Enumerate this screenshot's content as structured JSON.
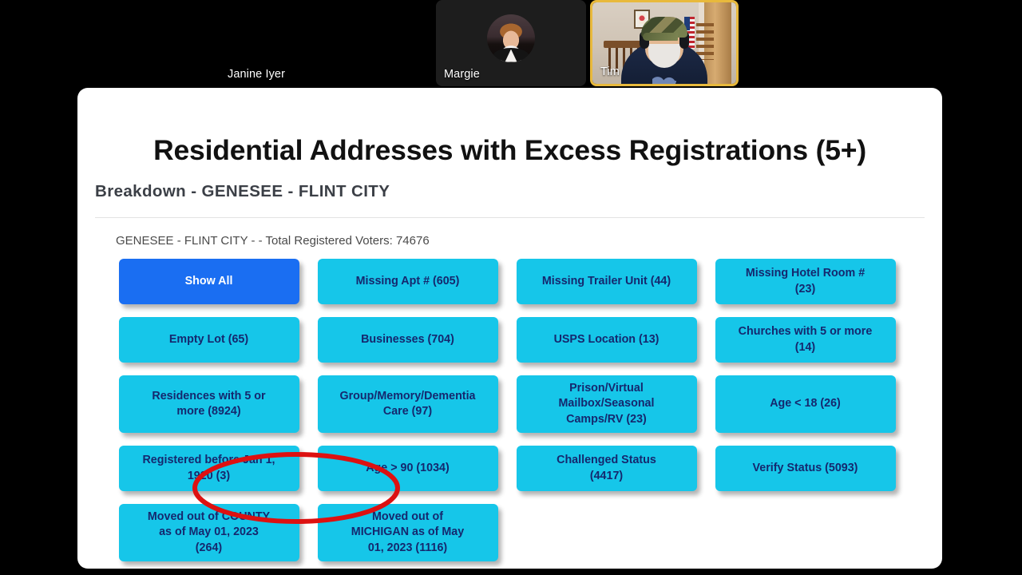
{
  "meeting": {
    "tiles": [
      {
        "name": "Janine Iyer",
        "state": "camera-off"
      },
      {
        "name": "Margie",
        "state": "avatar"
      },
      {
        "name": "Tim",
        "state": "active-speaker-video"
      }
    ]
  },
  "slide": {
    "title": "Residential Addresses with Excess Registrations (5+)",
    "subtitle": "Breakdown - GENESEE - FLINT CITY",
    "summary": "GENESEE - FLINT CITY - - Total Registered Voters: 74676",
    "colors": {
      "primary_button": "#1a6ef2",
      "filter_button": "#16c6e9",
      "filter_text": "#15286e",
      "highlight_ellipse": "#dd1111"
    },
    "filters": [
      {
        "label": "Show All",
        "primary": true,
        "tall": false
      },
      {
        "label": "Missing Apt # (605)",
        "primary": false,
        "tall": false
      },
      {
        "label": "Missing Trailer Unit (44)",
        "primary": false,
        "tall": false
      },
      {
        "label": "Missing Hotel Room #\n(23)",
        "primary": false,
        "tall": false
      },
      {
        "label": "Empty Lot (65)",
        "primary": false,
        "tall": false
      },
      {
        "label": "Businesses (704)",
        "primary": false,
        "tall": false
      },
      {
        "label": "USPS Location (13)",
        "primary": false,
        "tall": false
      },
      {
        "label": "Churches with 5 or more\n(14)",
        "primary": false,
        "tall": false
      },
      {
        "label": "Residences with 5 or\nmore (8924)",
        "primary": false,
        "tall": true
      },
      {
        "label": "Group/Memory/Dementia\nCare (97)",
        "primary": false,
        "tall": true
      },
      {
        "label": "Prison/Virtual\nMailbox/Seasonal\nCamps/RV (23)",
        "primary": false,
        "tall": true
      },
      {
        "label": "Age < 18 (26)",
        "primary": false,
        "tall": true
      },
      {
        "label": "Registered before Jan 1,\n1920 (3)",
        "primary": false,
        "tall": false
      },
      {
        "label": "Age > 90 (1034)",
        "primary": false,
        "tall": false
      },
      {
        "label": "Challenged Status\n(4417)",
        "primary": false,
        "tall": false
      },
      {
        "label": "Verify Status (5093)",
        "primary": false,
        "tall": false
      },
      {
        "label": "Moved out of COUNTY\nas of May 01, 2023\n(264)",
        "primary": false,
        "tall": true
      },
      {
        "label": "Moved out of\nMICHIGAN as of May\n01, 2023 (1116)",
        "primary": false,
        "tall": true
      }
    ],
    "annotation": {
      "type": "ellipse",
      "target_label": "Residences with 5 or more (8924)"
    }
  }
}
